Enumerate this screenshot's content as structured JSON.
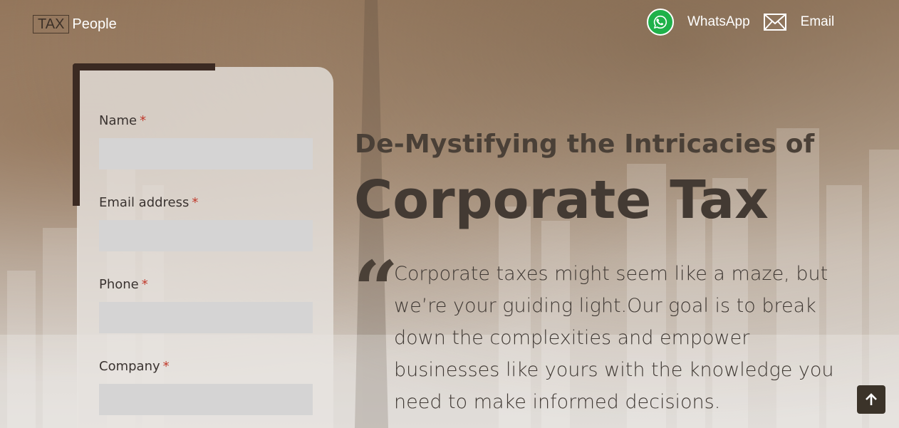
{
  "header": {
    "logo_box": "TAX",
    "logo_rest": "People",
    "whatsapp_label": "WhatsApp",
    "email_label": "Email"
  },
  "form": {
    "fields": [
      {
        "label": "Name",
        "required": "*",
        "value": ""
      },
      {
        "label": "Email address",
        "required": "*",
        "value": ""
      },
      {
        "label": "Phone",
        "required": "*",
        "value": ""
      },
      {
        "label": "Company",
        "required": "*",
        "value": ""
      }
    ]
  },
  "hero": {
    "subtitle": "De-Mystifying the Intricacies of",
    "title": "Corporate Tax",
    "quote_mark": "“",
    "text": "Corporate taxes might seem like a maze, but we’re your guiding light.Our goal is to break down the complexities and empower businesses like yours with the knowledge you need to make informed decisions."
  },
  "icons": {
    "whatsapp": "whatsapp-icon",
    "email": "mail-icon",
    "scroll_top": "arrow-up-icon"
  },
  "colors": {
    "whatsapp": "#1fb14a",
    "accent": "#3b2a22",
    "required": "#c0392b"
  }
}
